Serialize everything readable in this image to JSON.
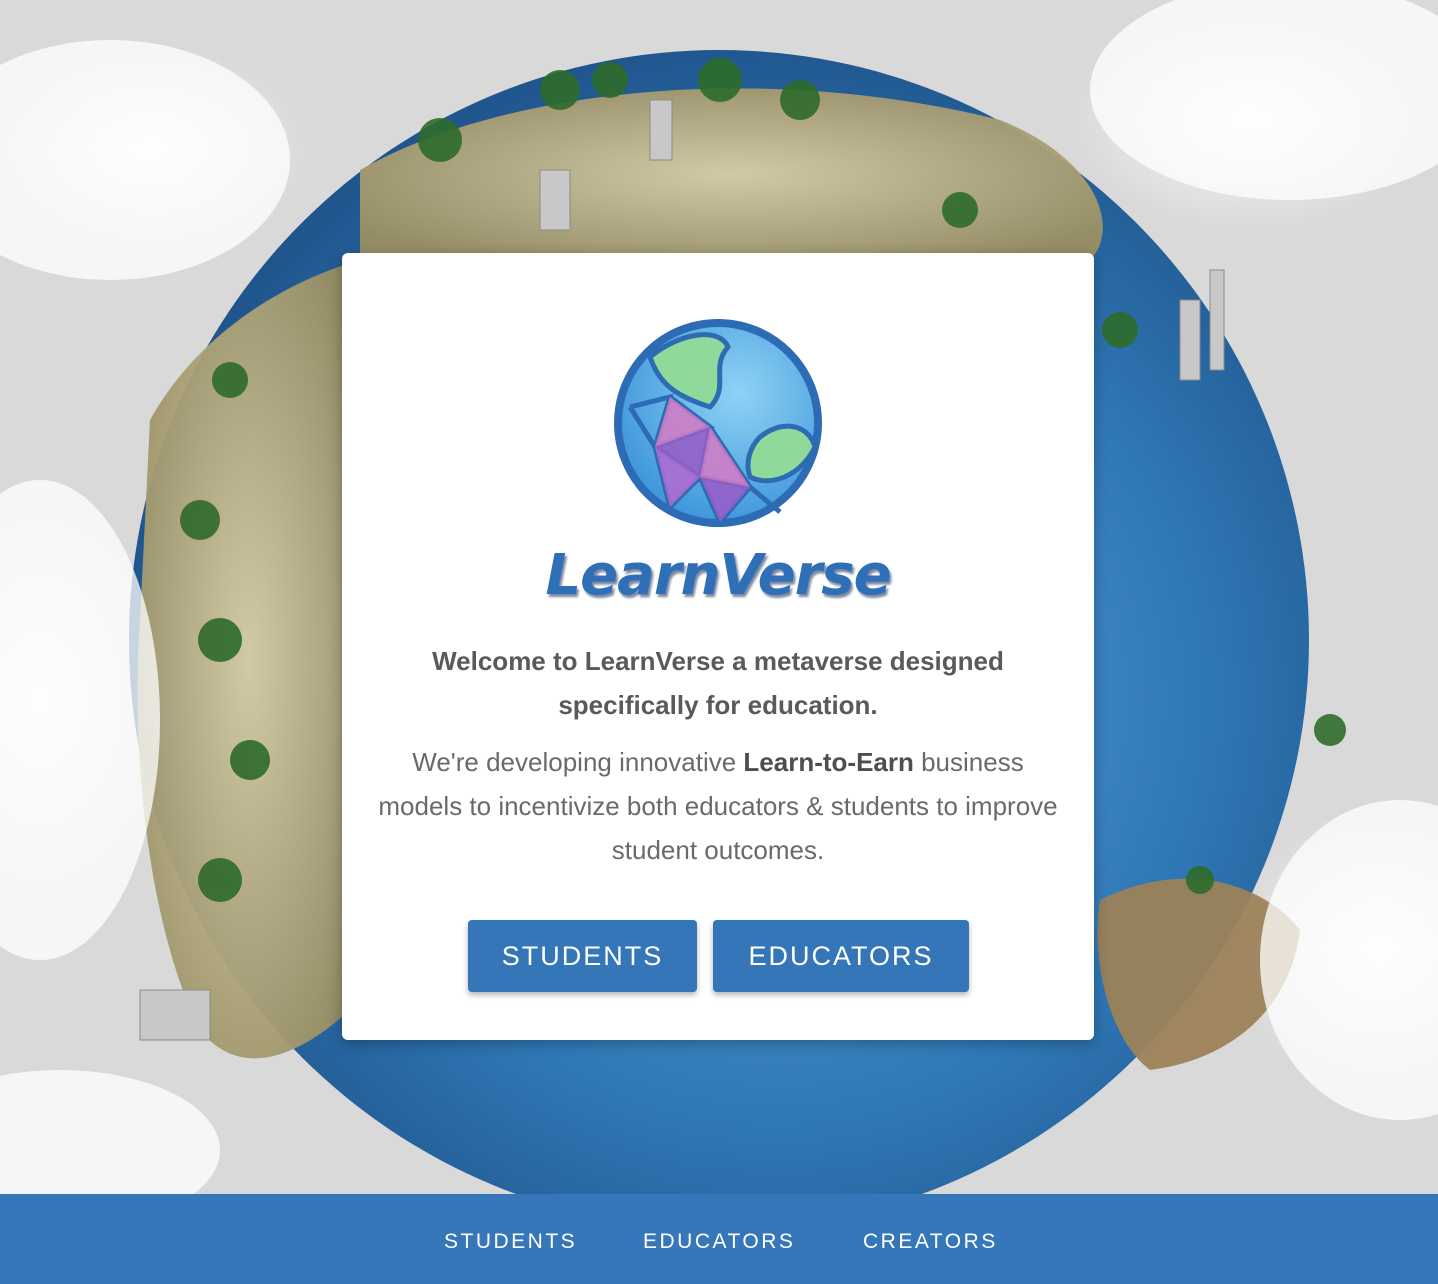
{
  "brand": {
    "name": "LearnVerse",
    "logo_icon": "globe-logo-icon"
  },
  "card": {
    "headline": "Welcome to LearnVerse a metaverse designed specifically for education.",
    "body_prefix": "We're developing innovative ",
    "body_bold": "Learn-to-Earn",
    "body_suffix": " business models to incentivize both educators & students to improve student outcomes."
  },
  "buttons": {
    "students_label": "STUDENTS",
    "educators_label": "EDUCATORS"
  },
  "footer_nav": {
    "students": "STUDENTS",
    "educators": "EDUCATORS",
    "creators": "CREATORS"
  },
  "colors": {
    "accent": "#3577b8",
    "brand_text": "#2f6fb7",
    "body_text": "#6a6a6a"
  }
}
